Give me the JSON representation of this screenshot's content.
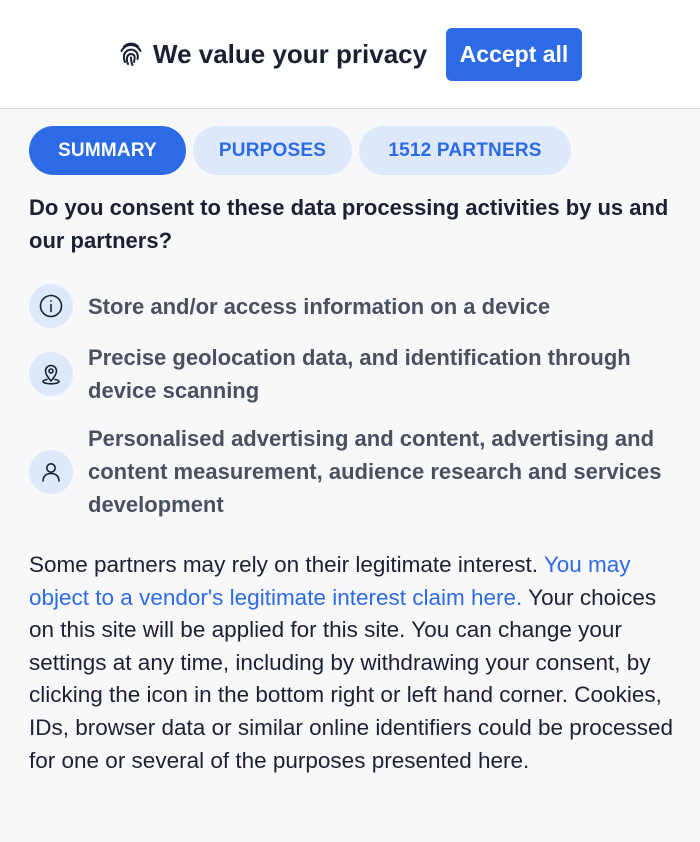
{
  "header": {
    "title": "We value your privacy",
    "accept_label": "Accept all",
    "brand_icon": "fingerprint-icon"
  },
  "tabs": [
    {
      "label": "SUMMARY",
      "active": true
    },
    {
      "label": "PURPOSES",
      "active": false
    },
    {
      "label": "1512 PARTNERS",
      "active": false
    }
  ],
  "question": "Do you consent to these data processing activities by us and our partners?",
  "purposes": [
    {
      "icon": "info-icon",
      "text": "Store and/or access information on a device"
    },
    {
      "icon": "location-pin-icon",
      "text": "Precise geolocation data, and identification through device scanning"
    },
    {
      "icon": "user-icon",
      "text": "Personalised advertising and content, advertising and content measurement, audience research and services development"
    }
  ],
  "notice": {
    "before_link": "Some partners may rely on their legitimate interest. ",
    "link": "You may object to a vendor's legitimate interest claim here.",
    "after_link": " Your choices on this site will be applied for this site. You can change your settings at any time, including by withdrawing your consent, by clicking the icon in the bottom right or left hand corner. Cookies, IDs, browser data or similar online identifiers could be processed for one or several of the purposes presented here."
  },
  "colors": {
    "accent": "#2c6be5",
    "accent_light": "#dde8fb",
    "background": "#f8f8fb"
  }
}
